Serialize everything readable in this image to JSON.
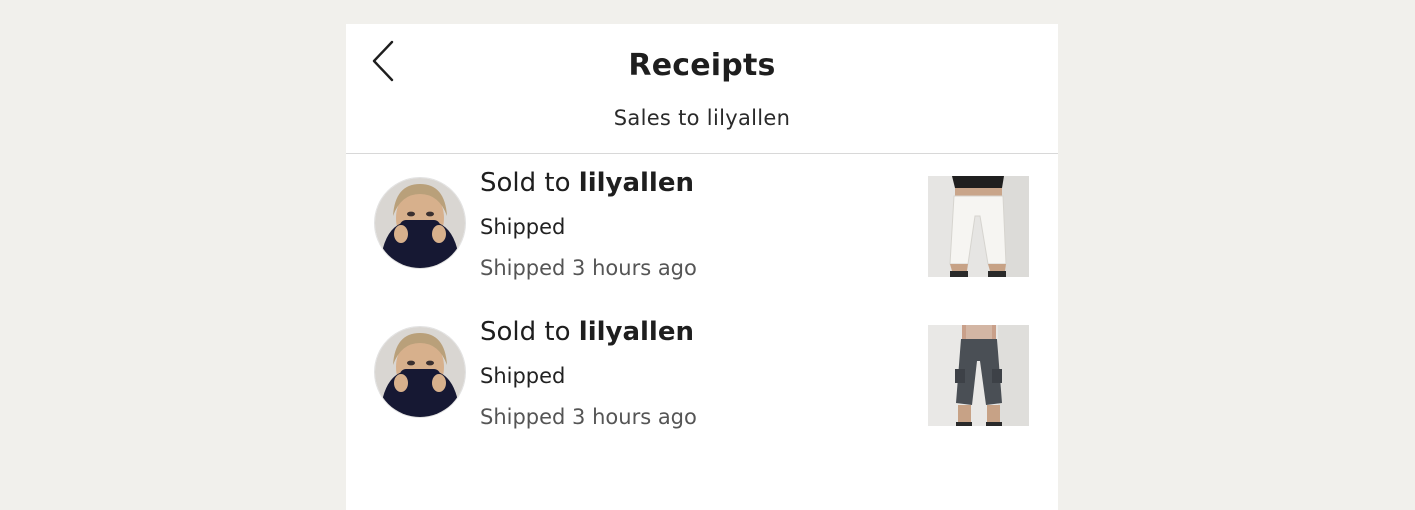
{
  "header": {
    "title": "Receipts",
    "subtitle": "Sales to lilyallen",
    "back_icon": "chevron-left-icon"
  },
  "receipts": [
    {
      "sold_prefix": "Sold to ",
      "buyer": "lilyallen",
      "status": "Shipped",
      "time": "Shipped 3 hours ago",
      "item_image": "white cropped trousers"
    },
    {
      "sold_prefix": "Sold to ",
      "buyer": "lilyallen",
      "status": "Shipped",
      "time": "Shipped 3 hours ago",
      "item_image": "dark grey cropped cargo trousers"
    }
  ],
  "colors": {
    "page_background": "#f1f0ec",
    "panel_background": "#ffffff",
    "divider": "#d8d8d8",
    "secondary_text": "#555555"
  }
}
